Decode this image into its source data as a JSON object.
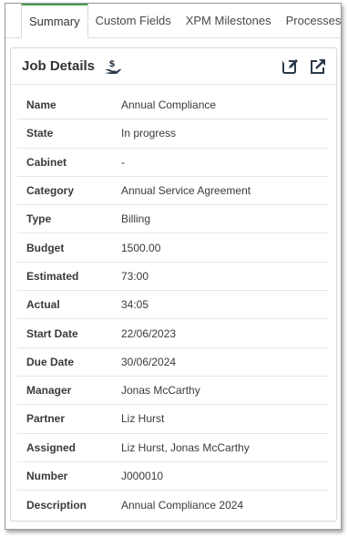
{
  "tabs": [
    {
      "label": "Summary",
      "active": true
    },
    {
      "label": "Custom Fields",
      "active": false
    },
    {
      "label": "XPM Milestones",
      "active": false
    },
    {
      "label": "Processes",
      "active": false
    }
  ],
  "panel": {
    "title": "Job Details",
    "title_icon": "hand-money-icon",
    "actions": [
      "edit-icon",
      "open-external-icon"
    ]
  },
  "details": [
    {
      "label": "Name",
      "value": "Annual Compliance"
    },
    {
      "label": "State",
      "value": "In progress"
    },
    {
      "label": "Cabinet",
      "value": "-"
    },
    {
      "label": "Category",
      "value": "Annual Service Agreement"
    },
    {
      "label": "Type",
      "value": "Billing"
    },
    {
      "label": "Budget",
      "value": "1500.00"
    },
    {
      "label": "Estimated",
      "value": "73:00"
    },
    {
      "label": "Actual",
      "value": "34:05"
    },
    {
      "label": "Start Date",
      "value": "22/06/2023"
    },
    {
      "label": "Due Date",
      "value": "30/06/2024"
    },
    {
      "label": "Manager",
      "value": "Jonas McCarthy"
    },
    {
      "label": "Partner",
      "value": "Liz Hurst"
    },
    {
      "label": "Assigned",
      "value": "Liz Hurst, Jonas McCarthy"
    },
    {
      "label": "Number",
      "value": "J000010"
    },
    {
      "label": "Description",
      "value": "Annual Compliance 2024"
    }
  ],
  "colors": {
    "active_tab_accent": "#3f9e4f",
    "icon_color": "#2b3a4a"
  }
}
